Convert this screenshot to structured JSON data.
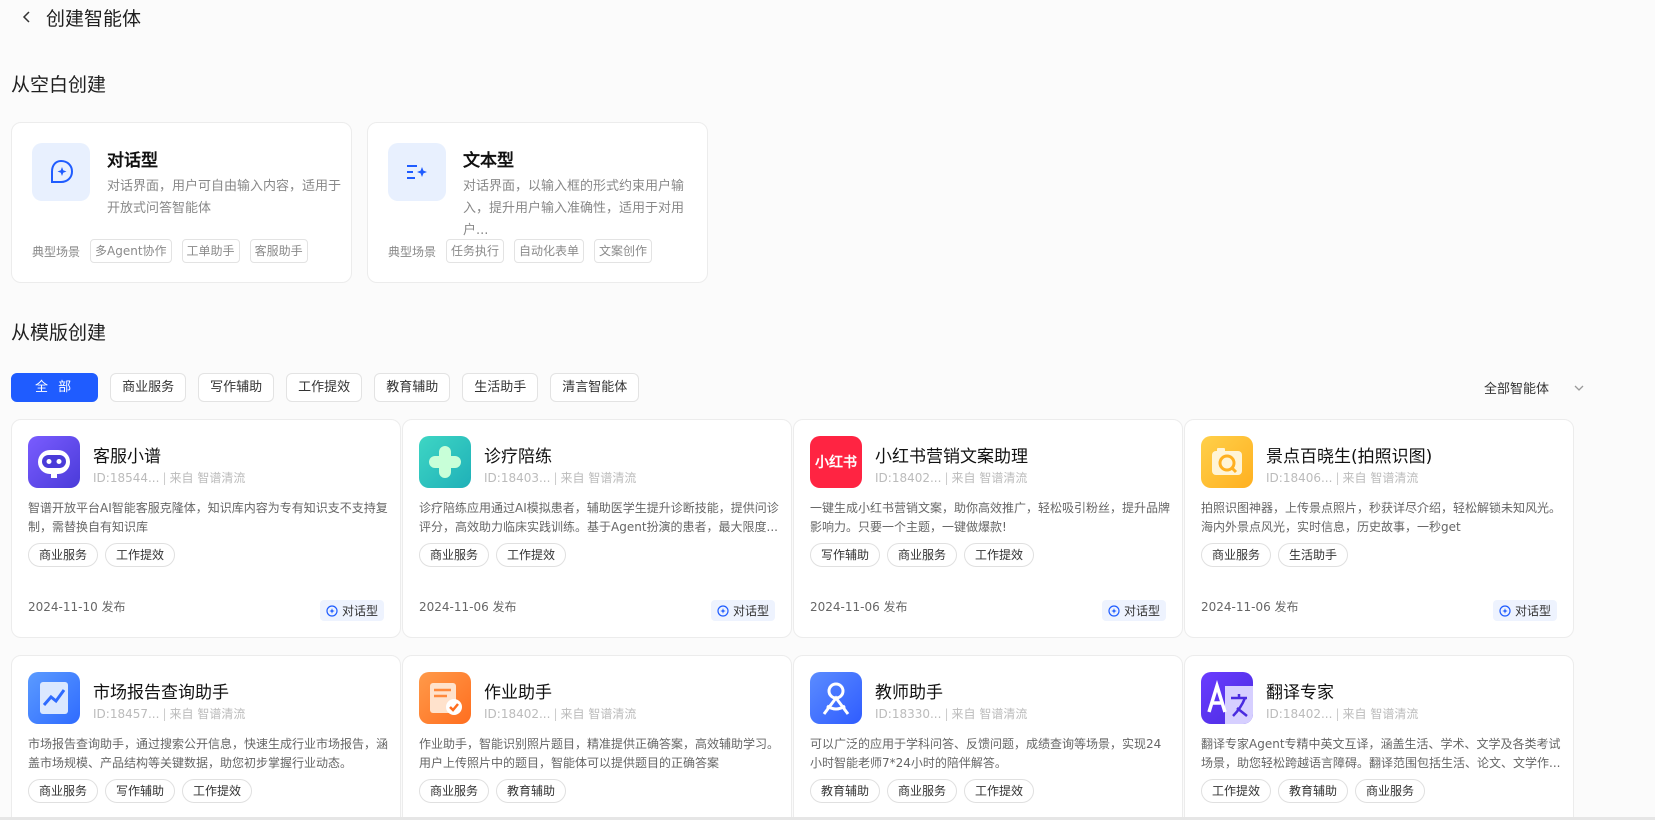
{
  "header": {
    "title": "创建智能体"
  },
  "blank_section": {
    "title": "从空白创建",
    "scene_label": "典型场景",
    "types": [
      {
        "name": "对话型",
        "desc": "对话界面，用户可自由输入内容，适用于开放式问答智能体",
        "tags": [
          "多Agent协作",
          "工单助手",
          "客服助手"
        ]
      },
      {
        "name": "文本型",
        "desc": "对话界面，以输入框的形式约束用户输入，提升用户输入准确性，适用于对用户...",
        "tags": [
          "任务执行",
          "自动化表单",
          "文案创作"
        ]
      }
    ]
  },
  "template_section": {
    "title": "从模版创建",
    "filters": [
      "全 部",
      "商业服务",
      "写作辅助",
      "工作提效",
      "教育辅助",
      "生活助手",
      "清言智能体"
    ],
    "active_filter": "全 部",
    "dropdown": "全部智能体"
  },
  "cards": [
    {
      "title": "客服小谱",
      "id": "ID:18544...",
      "source": "来自 智谱清流",
      "desc": "智谱开放平台AI智能客服克隆体，知识库内容为专有知识支不支持复制，需替换自有知识库",
      "tags": [
        "商业服务",
        "工作提效"
      ],
      "date": "2024-11-10 发布",
      "type": "对话型",
      "icon": "robot-icon"
    },
    {
      "title": "诊疗陪练",
      "id": "ID:18403...",
      "source": "来自 智谱清流",
      "desc": "诊疗陪练应用通过AI模拟患者，辅助医学生提升诊断技能，提供问诊评分，高效助力临床实践训练。基于Agent扮演的患者，最大限度...",
      "tags": [
        "商业服务",
        "工作提效"
      ],
      "date": "2024-11-06 发布",
      "type": "对话型",
      "icon": "medical-cross-icon"
    },
    {
      "title": "小红书营销文案助理",
      "id": "ID:18402...",
      "source": "来自 智谱清流",
      "desc": "一键生成小红书营销文案，助你高效推广，轻松吸引粉丝，提升品牌影响力。只要一个主题，一键做爆款!",
      "tags": [
        "写作辅助",
        "商业服务",
        "工作提效"
      ],
      "date": "2024-11-06 发布",
      "type": "对话型",
      "icon": "xiaohongshu-icon",
      "icon_text": "小红书"
    },
    {
      "title": "景点百晓生(拍照识图)",
      "id": "ID:18406...",
      "source": "来自 智谱清流",
      "desc": "拍照识图神器，上传景点照片，秒获详尽介绍，轻松解锁未知风光。海内外景点风光，实时信息，历史故事，一秒get",
      "tags": [
        "商业服务",
        "生活助手"
      ],
      "date": "2024-11-06 发布",
      "type": "对话型",
      "icon": "camera-search-icon"
    },
    {
      "title": "市场报告查询助手",
      "id": "ID:18457...",
      "source": "来自 智谱清流",
      "desc": "市场报告查询助手，通过搜索公开信息，快速生成行业市场报告，涵盖市场规模、产品结构等关键数据，助您初步掌握行业动态。",
      "tags": [
        "商业服务",
        "写作辅助",
        "工作提效"
      ],
      "icon": "chart-report-icon"
    },
    {
      "title": "作业助手",
      "id": "ID:18402...",
      "source": "来自 智谱清流",
      "desc": "作业助手，智能识别照片题目，精准提供正确答案，高效辅助学习。用户上传照片中的题目，智能体可以提供题目的正确答案",
      "tags": [
        "商业服务",
        "教育辅助"
      ],
      "icon": "homework-icon"
    },
    {
      "title": "教师助手",
      "id": "ID:18330...",
      "source": "来自 智谱清流",
      "desc": "可以广泛的应用于学科问答、反馈问题，成绩查询等场景，实现24小时智能老师7*24小时的陪伴解答。",
      "tags": [
        "教育辅助",
        "商业服务",
        "工作提效"
      ],
      "icon": "teacher-icon"
    },
    {
      "title": "翻译专家",
      "id": "ID:18402...",
      "source": "来自 智谱清流",
      "desc": "翻译专家Agent专精中英文互译，涵盖生活、学术、文学及各类考试场景，助您轻松跨越语言障碍。翻译范围包括生活、论文、文学作...",
      "tags": [
        "工作提效",
        "教育辅助",
        "商业服务"
      ],
      "icon": "translate-icon"
    }
  ]
}
